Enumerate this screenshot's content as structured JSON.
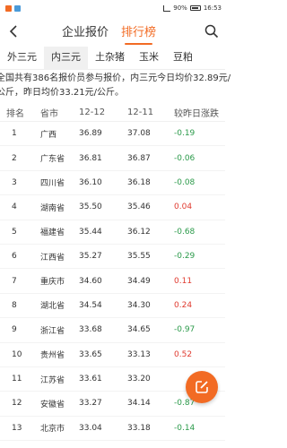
{
  "status_bar": {
    "battery": "90%",
    "time": "16:53"
  },
  "nav": {
    "tabs": [
      "企业报价",
      "排行榜"
    ],
    "active_tab": 1
  },
  "categories": {
    "items": [
      "外三元",
      "内三元",
      "土杂猪",
      "玉米",
      "豆粕"
    ],
    "active": 1
  },
  "notice": {
    "line1": "全国共有386名报价员参与报价，内三元今日均价32.89元/",
    "line2": "公斤，昨日均价33.21元/公斤。"
  },
  "table": {
    "headers": {
      "rank": "排名",
      "province": "省市",
      "date1": "12-12",
      "date2": "12-11",
      "change": "较昨日涨跌"
    },
    "rows": [
      {
        "rank": "1",
        "province": "广西",
        "d1": "36.89",
        "d2": "37.08",
        "change": "-0.19"
      },
      {
        "rank": "2",
        "province": "广东省",
        "d1": "36.81",
        "d2": "36.87",
        "change": "-0.06"
      },
      {
        "rank": "3",
        "province": "四川省",
        "d1": "36.10",
        "d2": "36.18",
        "change": "-0.08"
      },
      {
        "rank": "4",
        "province": "湖南省",
        "d1": "35.50",
        "d2": "35.46",
        "change": "0.04"
      },
      {
        "rank": "5",
        "province": "福建省",
        "d1": "35.44",
        "d2": "36.12",
        "change": "-0.68"
      },
      {
        "rank": "6",
        "province": "江西省",
        "d1": "35.27",
        "d2": "35.55",
        "change": "-0.29"
      },
      {
        "rank": "7",
        "province": "重庆市",
        "d1": "34.60",
        "d2": "34.49",
        "change": "0.11"
      },
      {
        "rank": "8",
        "province": "湖北省",
        "d1": "34.54",
        "d2": "34.30",
        "change": "0.24"
      },
      {
        "rank": "9",
        "province": "浙江省",
        "d1": "33.68",
        "d2": "34.65",
        "change": "-0.97"
      },
      {
        "rank": "10",
        "province": "贵州省",
        "d1": "33.65",
        "d2": "33.13",
        "change": "0.52"
      },
      {
        "rank": "11",
        "province": "江苏省",
        "d1": "33.61",
        "d2": "33.20",
        "change": ""
      },
      {
        "rank": "12",
        "province": "安徽省",
        "d1": "33.27",
        "d2": "34.14",
        "change": "-0.87"
      },
      {
        "rank": "13",
        "province": "北京市",
        "d1": "33.04",
        "d2": "33.18",
        "change": "-0.14"
      }
    ]
  },
  "colors": {
    "accent": "#f26b24",
    "down": "#2b9a4a",
    "up": "#e03a2f"
  },
  "icons": {
    "back": "back-arrow-icon",
    "search": "search-icon",
    "fab": "edit-icon"
  }
}
